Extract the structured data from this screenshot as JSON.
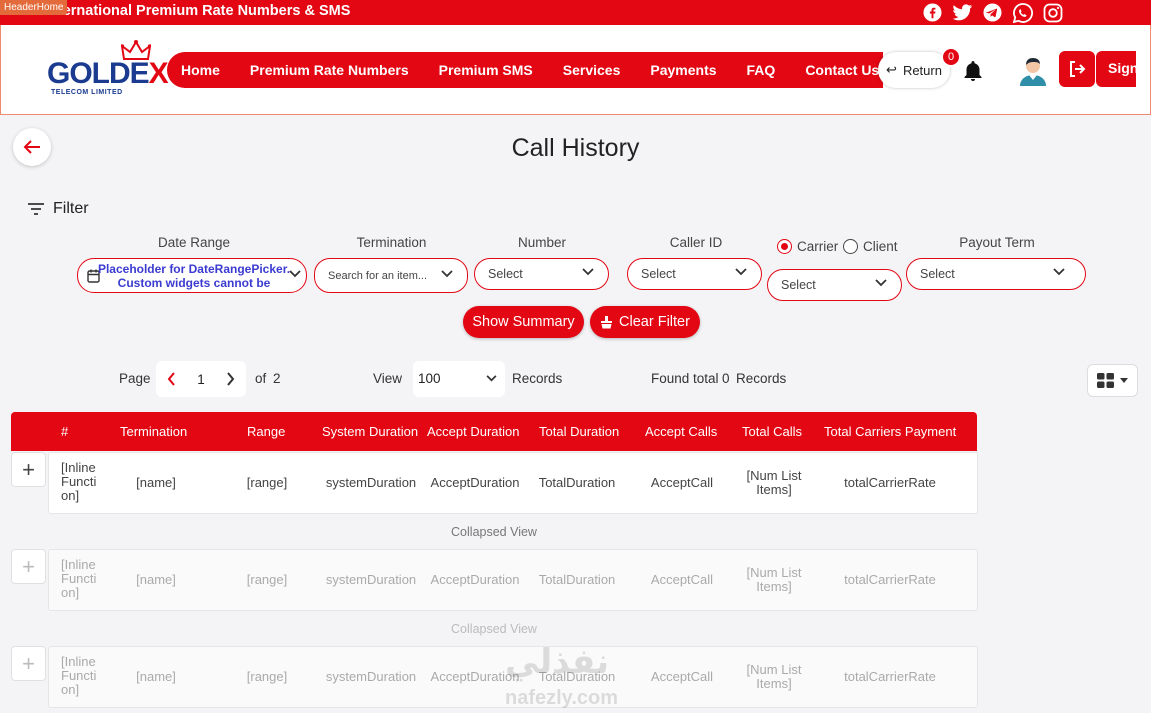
{
  "topbar": {
    "header_tag": "HeaderHome",
    "title": "International Premium Rate Numbers & SMS",
    "socials": [
      "facebook-icon",
      "twitter-icon",
      "telegram-icon",
      "whatsapp-icon",
      "instagram-icon"
    ]
  },
  "header": {
    "logo_text": "GOLDEX",
    "logo_sub": "TELECOM LIMITED",
    "nav": [
      "Home",
      "Premium Rate Numbers",
      "Premium SMS",
      "Services",
      "Payments",
      "FAQ",
      "Contact Us"
    ],
    "return_label": "Return",
    "notification_count": "0",
    "signin_label": "Sign"
  },
  "page": {
    "title": "Call History",
    "filter_label": "Filter"
  },
  "filters": {
    "date_range_label": "Date Range",
    "date_range_value": "Placeholder for DateRangePicker. Custom widgets cannot be",
    "termination_label": "Termination",
    "termination_placeholder": "Search for an item...",
    "number_label": "Number",
    "number_value": "Select",
    "caller_id_label": "Caller ID",
    "caller_id_value": "Select",
    "carrier_label": "Carrier",
    "client_label": "Client",
    "carrier_value": "Select",
    "payout_term_label": "Payout Term",
    "payout_term_value": "Select",
    "show_summary": "Show Summary",
    "clear_filter": "Clear Filter"
  },
  "pagination": {
    "page_label": "Page",
    "current_page": "1",
    "of_label": "of",
    "total_pages": "2",
    "view_label": "View",
    "view_value": "100",
    "records_label": "Records",
    "found_label": "Found total",
    "found_count": "0",
    "found_records_label": "Records"
  },
  "table": {
    "headers": [
      "#",
      "Termination",
      "Range",
      "System Duration",
      "Accept Duration",
      "Total Duration",
      "Accept Calls",
      "Total Calls",
      "Total Carriers Payment"
    ],
    "rows": [
      {
        "num": "[Inline Functi on]",
        "termination": "[name]",
        "range": "[range]",
        "system": "systemDuration",
        "accept_dur": "AcceptDuration",
        "total_dur": "TotalDuration",
        "accept_calls": "AcceptCall",
        "total_calls": "[Num List Items]",
        "payment": "totalCarrierRate"
      },
      {
        "num": "[Inline Functi on]",
        "termination": "[name]",
        "range": "[range]",
        "system": "systemDuration",
        "accept_dur": "AcceptDuration",
        "total_dur": "TotalDuration",
        "accept_calls": "AcceptCall",
        "total_calls": "[Num List Items]",
        "payment": "totalCarrierRate"
      },
      {
        "num": "[Inline Functi on]",
        "termination": "[name]",
        "range": "[range]",
        "system": "systemDuration",
        "accept_dur": "AcceptDuration",
        "total_dur": "TotalDuration",
        "accept_calls": "AcceptCall",
        "total_calls": "[Num List Items]",
        "payment": "totalCarrierRate"
      }
    ],
    "collapsed_label": "Collapsed View"
  },
  "watermark": {
    "arabic": "نفذلي",
    "latin": "nafezly.com"
  },
  "colors": {
    "brand_red": "#e30613",
    "logo_blue": "#1a3b8f"
  }
}
